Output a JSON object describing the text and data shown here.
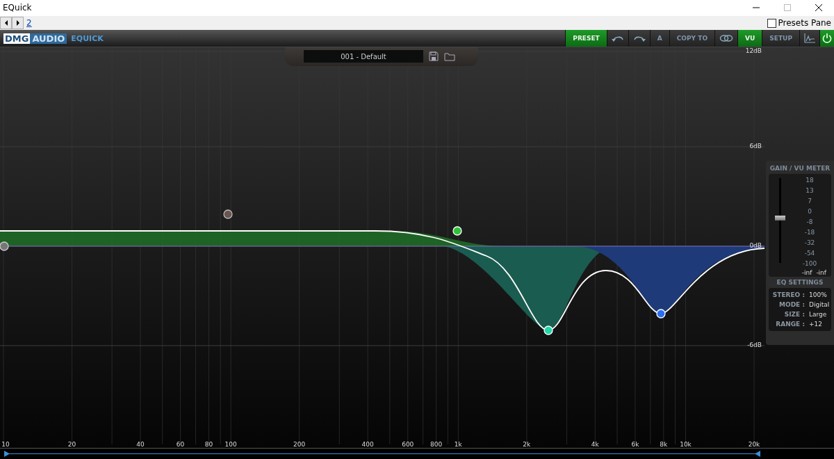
{
  "window": {
    "title": "EQuick"
  },
  "nav": {
    "page_link": "2",
    "presets_pane": {
      "label": "Presets Pane",
      "checked": false
    }
  },
  "header": {
    "brand_left": "DMG",
    "brand_right": "AUDIO",
    "product": "EQUICK",
    "buttons": [
      {
        "kind": "text",
        "label": "PRESET",
        "on": true
      },
      {
        "kind": "undo",
        "on": false
      },
      {
        "kind": "redo",
        "on": false
      },
      {
        "kind": "text",
        "label": "A",
        "on": false
      },
      {
        "kind": "text",
        "label": "COPY TO",
        "on": false
      },
      {
        "kind": "link",
        "on": false
      },
      {
        "kind": "text",
        "label": "VU",
        "on": true
      },
      {
        "kind": "text",
        "label": "SETUP",
        "on": false
      },
      {
        "kind": "analyzer",
        "on": false
      },
      {
        "kind": "power",
        "on": true
      }
    ]
  },
  "preset": {
    "name": "001 - Default"
  },
  "graph": {
    "db_labels": [
      "12dB",
      "6dB",
      "0dB",
      "-6dB"
    ],
    "freq_labels": [
      "10",
      "20",
      "40",
      "60",
      "80",
      "100",
      "200",
      "400",
      "600",
      "800",
      "1k",
      "2k",
      "4k",
      "6k",
      "8k",
      "10k",
      "20k"
    ]
  },
  "meter": {
    "title": "GAIN / VU METER",
    "scale": [
      "18",
      "13",
      "7",
      "0",
      "-8",
      "-18",
      "-32",
      "-54",
      "-100"
    ],
    "readings": [
      "-inf",
      "-inf"
    ],
    "gain": {
      "level": 0.53
    }
  },
  "settings": {
    "title": "EQ SETTINGS",
    "rows": [
      {
        "label": "STEREO :",
        "value": "100%"
      },
      {
        "label": "MODE :",
        "value": "Digital"
      },
      {
        "label": "SIZE :",
        "value": "Large"
      },
      {
        "label": "RANGE :",
        "value": "+12"
      }
    ]
  }
}
